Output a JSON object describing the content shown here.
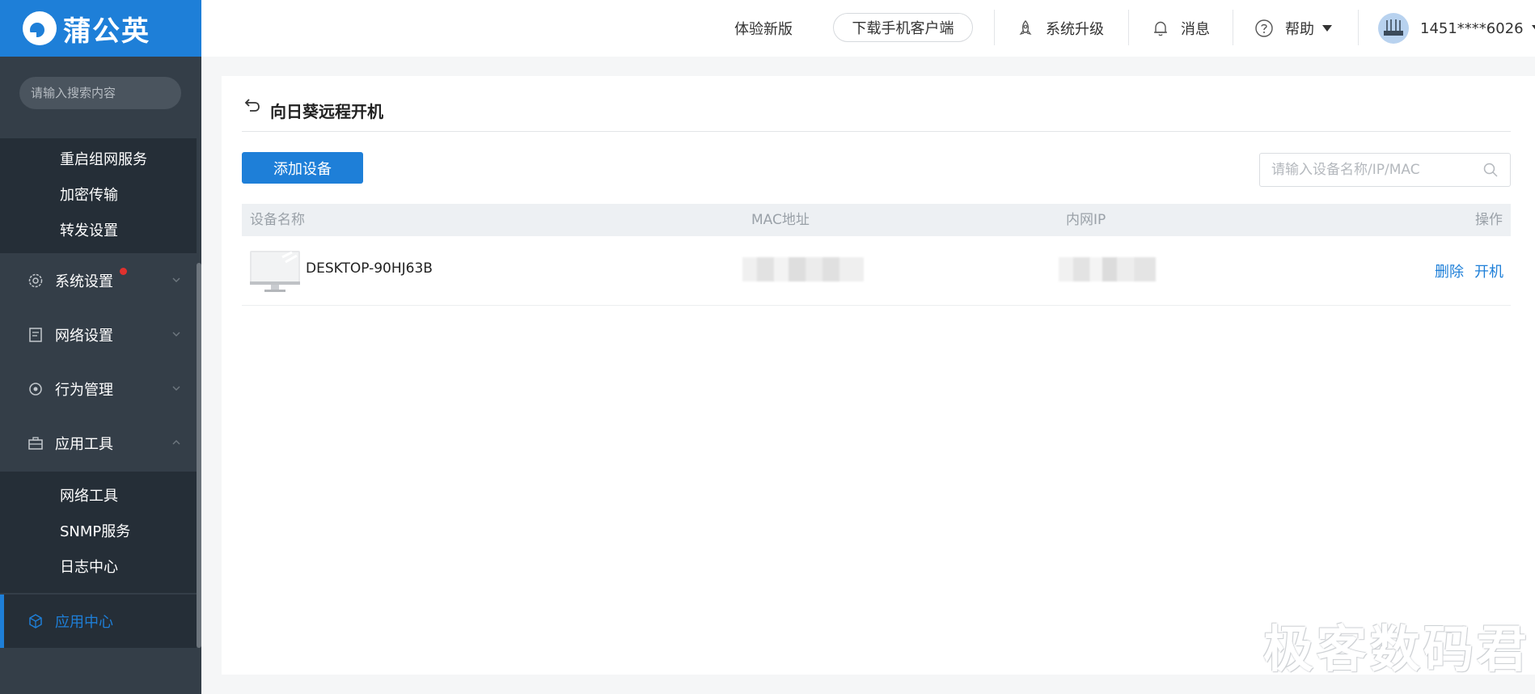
{
  "brand": {
    "name": "蒲公英",
    "color": "#1e7fd8"
  },
  "sidebar": {
    "search_placeholder": "请输入搜索内容",
    "submenu_top": [
      "重启组网服务",
      "加密传输",
      "转发设置"
    ],
    "menu": [
      {
        "label": "系统设置",
        "icon": "gear-icon",
        "has_dot": true
      },
      {
        "label": "网络设置",
        "icon": "network-settings-icon"
      },
      {
        "label": "行为管理",
        "icon": "behavior-icon"
      },
      {
        "label": "应用工具",
        "icon": "toolbox-icon",
        "expanded": true
      }
    ],
    "submenu_tools": [
      "网络工具",
      "SNMP服务",
      "日志中心"
    ],
    "active_item": {
      "label": "应用中心",
      "icon": "cube-icon"
    }
  },
  "header": {
    "new_version": "体验新版",
    "download_client": "下载手机客户端",
    "upgrade": "系统升级",
    "messages": "消息",
    "help": "帮助",
    "account": "1451****6026"
  },
  "page": {
    "title": "向日葵远程开机",
    "add_device": "添加设备",
    "search_placeholder": "请输入设备名称/IP/MAC",
    "columns": [
      "设备名称",
      "MAC地址",
      "内网IP",
      "操作"
    ],
    "rows": [
      {
        "name": "DESKTOP-90HJ63B",
        "actions": [
          "删除",
          "开机"
        ]
      }
    ]
  },
  "watermark": "极客数码君"
}
